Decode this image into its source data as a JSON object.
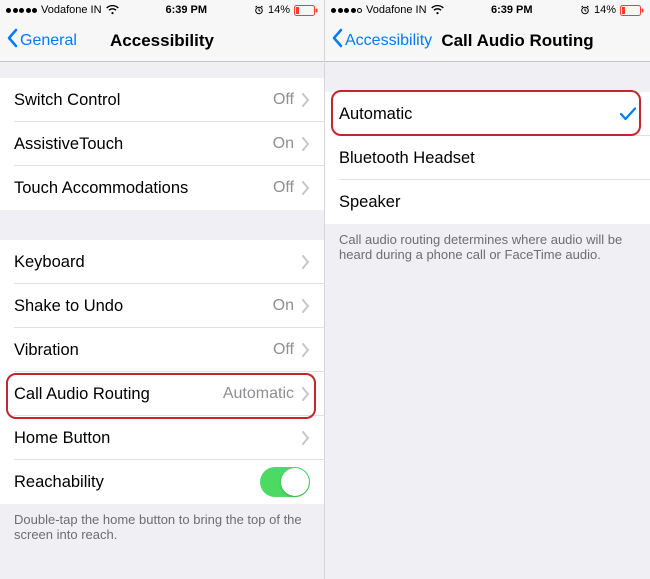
{
  "status": {
    "carrier": "Vodafone IN",
    "time": "6:39 PM",
    "battery_pct": "14%",
    "signal_full": 5,
    "signal_full_right": 4
  },
  "left": {
    "back_label": "General",
    "title": "Accessibility",
    "rows": {
      "switch_control": {
        "label": "Switch Control",
        "value": "Off"
      },
      "assistive_touch": {
        "label": "AssistiveTouch",
        "value": "On"
      },
      "touch_accommodations": {
        "label": "Touch Accommodations",
        "value": "Off"
      },
      "keyboard": {
        "label": "Keyboard"
      },
      "shake_to_undo": {
        "label": "Shake to Undo",
        "value": "On"
      },
      "vibration": {
        "label": "Vibration",
        "value": "Off"
      },
      "call_audio_routing": {
        "label": "Call Audio Routing",
        "value": "Automatic"
      },
      "home_button": {
        "label": "Home Button"
      },
      "reachability": {
        "label": "Reachability"
      }
    },
    "footer": "Double-tap the home button to bring the top of the screen into reach."
  },
  "right": {
    "back_label": "Accessibility",
    "title": "Call Audio Routing",
    "options": {
      "automatic": {
        "label": "Automatic",
        "selected": true
      },
      "bluetooth_headset": {
        "label": "Bluetooth Headset"
      },
      "speaker": {
        "label": "Speaker"
      }
    },
    "footer": "Call audio routing determines where audio will be heard during a phone call or FaceTime audio."
  }
}
